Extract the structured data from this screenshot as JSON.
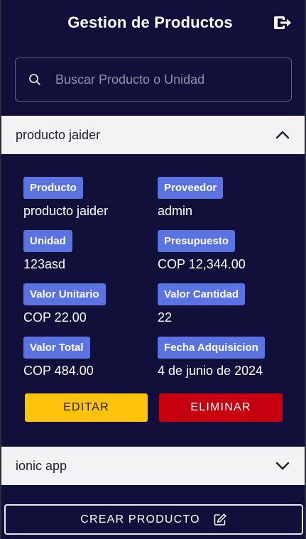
{
  "header": {
    "title": "Gestion de Productos",
    "logout_icon": "logout-icon"
  },
  "search": {
    "placeholder": "Buscar Producto o Unidad",
    "value": ""
  },
  "products": [
    {
      "name": "producto jaider",
      "expanded": true,
      "fields": {
        "producto": {
          "label": "Producto",
          "value": "producto jaider"
        },
        "proveedor": {
          "label": "Proveedor",
          "value": "admin"
        },
        "unidad": {
          "label": "Unidad",
          "value": "123asd"
        },
        "presupuesto": {
          "label": "Presupuesto",
          "value": "COP 12,344.00"
        },
        "valor_unitario": {
          "label": "Valor Unitario",
          "value": "COP 22.00"
        },
        "valor_cantidad": {
          "label": "Valor Cantidad",
          "value": "22"
        },
        "valor_total": {
          "label": "Valor Total",
          "value": "COP 484.00"
        },
        "fecha": {
          "label": "Fecha Adquisicion",
          "value": "4 de junio de 2024"
        }
      },
      "edit_label": "EDITAR",
      "delete_label": "ELIMINAR"
    },
    {
      "name": "ionic app",
      "expanded": false
    }
  ],
  "create_label": "CREAR PRODUCTO",
  "colors": {
    "background": "#10103a",
    "badge": "#5b73e0",
    "edit": "#ffc409",
    "delete": "#c5000f"
  }
}
